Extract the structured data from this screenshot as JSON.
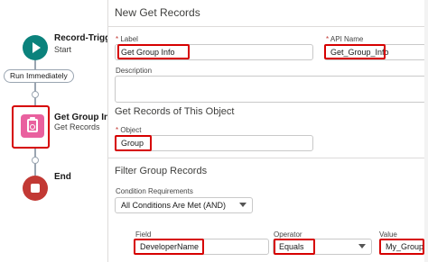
{
  "flow": {
    "start": {
      "title": "Record-Triggered Flow",
      "subtitle": "Start"
    },
    "run_label": "Run Immediately",
    "get_records": {
      "title": "Get Group Info",
      "subtitle": "Get Records"
    },
    "end": {
      "title": "End"
    }
  },
  "panel": {
    "title": "New Get Records",
    "label_field": {
      "label": "Label",
      "value": "Get Group Info"
    },
    "api_name_field": {
      "label": "API Name",
      "value": "Get_Group_Info"
    },
    "description_label": "Description",
    "object_section": {
      "title": "Get Records of This Object",
      "object_label": "Object",
      "object_value": "Group"
    },
    "filter_section": {
      "title": "Filter Group Records",
      "condition_label": "Condition Requirements",
      "condition_value": "All Conditions Are Met (AND)",
      "field_label": "Field",
      "field_value": "DeveloperName",
      "operator_label": "Operator",
      "operator_value": "Equals",
      "value_label": "Value",
      "value_value": "My_Group"
    }
  },
  "colors": {
    "start": "#0b827c",
    "get_records": "#e9619f",
    "end": "#c23934",
    "highlight": "#d60000"
  }
}
